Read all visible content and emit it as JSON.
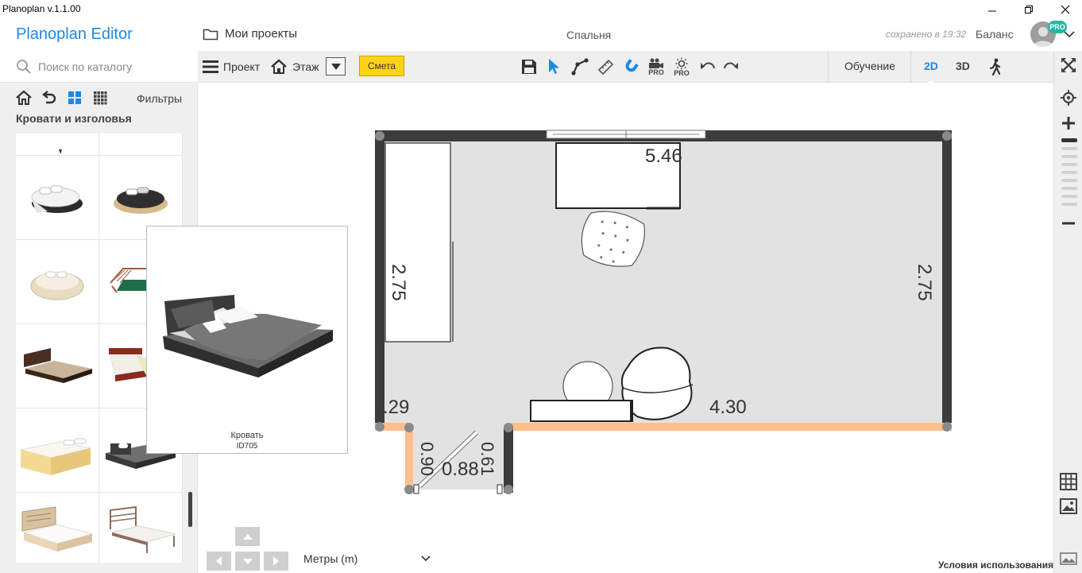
{
  "window": {
    "title": "Planoplan v.1.1.00"
  },
  "header": {
    "brand": "Planoplan Editor",
    "projects_label": "Мои проекты",
    "room_name": "Спальня",
    "saved_status": "сохранено в 19:32",
    "balance_label": "Баланс",
    "pro_badge": "PRO"
  },
  "sidebar": {
    "search_placeholder": "Поиск по каталогу",
    "filters_label": "Фильтры",
    "category_title": "Кровати и изголовья",
    "tiles": [
      "bed-round-white",
      "bed-round-black",
      "bed-round-beige",
      "bed-green-frame",
      "bed-wood-dark",
      "bed-red-wood",
      "bed-pine-drawers",
      "bed-grey-platform",
      "bed-carved-beige",
      "bed-metal-frame"
    ]
  },
  "popup": {
    "name": "Кровать",
    "id": "ID705"
  },
  "toolbar": {
    "project_label": "Проект",
    "floor_label": "Этаж",
    "estimate_label": "Смета",
    "pro_label": "PRO",
    "learn_label": "Обучение",
    "mode_2d": "2D",
    "mode_3d": "3D",
    "active_mode": "2D"
  },
  "plan": {
    "dim_top": "5.46",
    "dim_left": "2.75",
    "dim_right": "2.75",
    "dim_bottom": "4.30",
    "dim_corner": ".29",
    "dim_door_a": "0.90",
    "dim_door_b": "0.88",
    "dim_door_c": "0.61"
  },
  "footer": {
    "units_label": "Метры (m)",
    "terms_label": "Условия использования"
  },
  "colors": {
    "brand": "#1e88e5",
    "accent_yellow": "#ffd21a",
    "wall": "#3c3c3c",
    "wall_highlight": "#ffbe8a",
    "floor": "#e2e2e2",
    "pro_badge": "#26b5a5"
  }
}
